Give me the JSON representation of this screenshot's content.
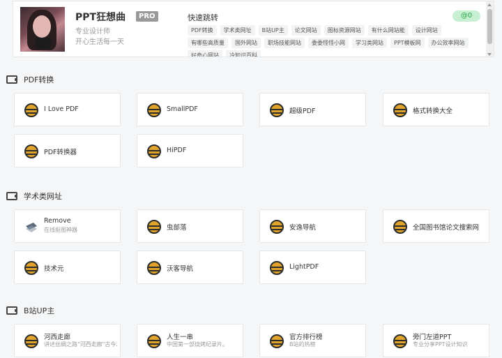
{
  "profile": {
    "name": "PPT狂想曲",
    "pro": "PRO",
    "role": "专业设计师",
    "motto": "开心生活每一天"
  },
  "quick_jump": {
    "title": "快速跳转",
    "badge": "@0",
    "tags": [
      "PDF转换",
      "学术类网址",
      "B站UP主",
      "论文网站",
      "图标资源网站",
      "有什么网站能",
      "设计网站",
      "有哪些高质量",
      "国外网站",
      "职场技能网站",
      "委委怪怪小网",
      "学习类网站",
      "PPT模板网",
      "办公效率网站",
      "好奇心网站",
      "冷知识百科"
    ]
  },
  "sections": [
    {
      "title": "PDF转换",
      "cards": [
        {
          "title": "I Love PDF"
        },
        {
          "title": "SmallPDF"
        },
        {
          "title": "超级PDF"
        },
        {
          "title": "格式转换大全"
        },
        {
          "title": "PDF转换器"
        },
        {
          "title": "HiPDF"
        }
      ]
    },
    {
      "title": "学术类网址",
      "cards": [
        {
          "title": "Remove",
          "sub": "在线抠图神器",
          "icon": "layers-icon"
        },
        {
          "title": "虫部落"
        },
        {
          "title": "安逸导航"
        },
        {
          "title": "全国图书馆论文搜索网"
        },
        {
          "title": "技术元"
        },
        {
          "title": "沃客导航"
        },
        {
          "title": "LightPDF"
        }
      ]
    },
    {
      "title": "B站UP主",
      "cards": [
        {
          "title": "河西走廊",
          "sub": "讲述丝绸之路\"河西走廊\"古今发展史的纪录片"
        },
        {
          "title": "人生一串",
          "sub": "中国第一部烧烤纪录片。"
        },
        {
          "title": "官方排行榜",
          "sub": "B站的热榜"
        },
        {
          "title": "旁门左道PPT",
          "sub": "专业分享PPT设计知识"
        }
      ]
    }
  ],
  "colors": {
    "badge_bg": "#c7f0d2",
    "badge_text": "#2aa84a",
    "icon_gold": "#e0a52a"
  }
}
